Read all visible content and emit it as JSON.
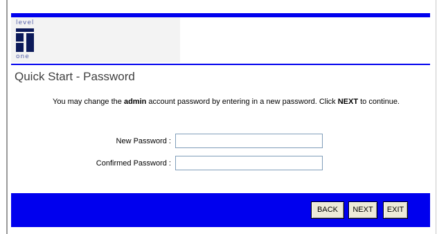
{
  "logo": {
    "top_text": "level",
    "bottom_text": "one"
  },
  "title": "Quick Start - Password",
  "description": {
    "part1": "You may change the ",
    "bold1": "admin",
    "part2": " account password by entering in a new password. Click ",
    "bold2": "NEXT",
    "part3": " to continue."
  },
  "form": {
    "new_password_label": "New Password :",
    "new_password_value": "",
    "confirm_password_label": "Confirmed Password :",
    "confirm_password_value": ""
  },
  "buttons": {
    "back": "BACK",
    "next": "NEXT",
    "exit": "EXIT"
  },
  "colors": {
    "accent_blue": "#0000ee",
    "title_gray": "#404040"
  }
}
